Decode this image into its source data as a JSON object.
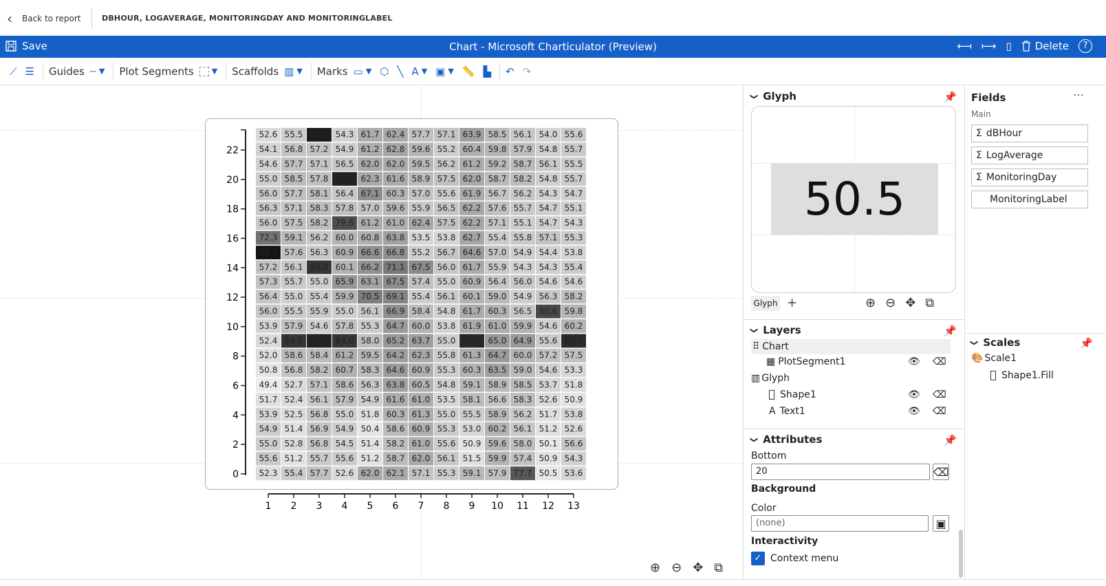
{
  "header": {
    "back_label": "Back to report",
    "report_title": "DBHOUR, LOGAVERAGE, MONITORINGDAY AND MONITORINGLABEL"
  },
  "titlebar": {
    "save_label": "Save",
    "title": "Chart - Microsoft Charticulator (Preview)",
    "delete_label": "Delete"
  },
  "toolbar": {
    "guides_label": "Guides",
    "plot_segments_label": "Plot Segments",
    "scaffolds_label": "Scaffolds",
    "marks_label": "Marks"
  },
  "glyph_panel": {
    "title": "Glyph",
    "preview_value": "50.5",
    "tab_label": "Glyph"
  },
  "layers_panel": {
    "title": "Layers",
    "items": [
      {
        "label": "Chart"
      },
      {
        "label": "PlotSegment1"
      },
      {
        "label": "Glyph"
      },
      {
        "label": "Shape1"
      },
      {
        "label": "Text1"
      }
    ]
  },
  "attributes_panel": {
    "title": "Attributes",
    "bottom_label": "Bottom",
    "bottom_value": "20",
    "background_label": "Background",
    "color_label": "Color",
    "color_value": "(none)",
    "interactivity_label": "Interactivity",
    "context_menu_label": "Context menu",
    "context_menu_checked": true
  },
  "fields_panel": {
    "title": "Fields",
    "group": "Main",
    "fields": [
      {
        "label": "dBHour",
        "sigma": true
      },
      {
        "label": "LogAverage",
        "sigma": true
      },
      {
        "label": "MonitoringDay",
        "sigma": true
      },
      {
        "label": "MonitoringLabel",
        "sigma": false
      }
    ]
  },
  "scales_panel": {
    "title": "Scales",
    "scale_name": "Scale1",
    "scale_item": "Shape1.Fill"
  },
  "colors": {
    "accent": "#1560c8"
  },
  "chart_data": {
    "type": "heatmap",
    "x_ticks": [
      "1",
      "2",
      "3",
      "4",
      "5",
      "6",
      "7",
      "8",
      "9",
      "10",
      "11",
      "12",
      "13"
    ],
    "y_ticks": [
      "0",
      "2",
      "4",
      "6",
      "8",
      "10",
      "12",
      "14",
      "16",
      "18",
      "20",
      "22"
    ],
    "rows_top_to_bottom": [
      [
        52.6,
        55.5,
        88.9,
        54.3,
        61.7,
        62.4,
        57.7,
        57.1,
        63.9,
        58.5,
        56.1,
        54.0,
        55.6
      ],
      [
        54.1,
        56.8,
        57.2,
        54.9,
        61.2,
        62.8,
        59.6,
        55.2,
        60.4,
        59.8,
        57.9,
        54.8,
        55.7
      ],
      [
        54.6,
        57.7,
        57.1,
        56.5,
        62.0,
        62.0,
        59.5,
        56.2,
        61.2,
        59.2,
        58.7,
        56.1,
        55.5
      ],
      [
        55.0,
        58.5,
        57.8,
        87.9,
        62.3,
        61.6,
        58.9,
        57.5,
        62.0,
        58.7,
        58.2,
        54.8,
        55.7
      ],
      [
        56.0,
        57.7,
        58.1,
        56.4,
        67.1,
        60.3,
        57.0,
        55.6,
        61.9,
        56.7,
        56.2,
        54.3,
        54.7
      ],
      [
        56.3,
        57.1,
        58.3,
        57.8,
        57.0,
        59.6,
        55.9,
        56.5,
        62.2,
        57.6,
        55.7,
        54.7,
        55.1
      ],
      [
        56.0,
        57.5,
        58.2,
        79.6,
        61.2,
        61.0,
        62.4,
        57.5,
        62.2,
        57.1,
        55.1,
        54.7,
        54.3
      ],
      [
        72.3,
        59.1,
        56.2,
        60.0,
        60.8,
        63.8,
        53.5,
        53.8,
        62.7,
        55.4,
        55.8,
        57.1,
        55.3
      ],
      [
        90.5,
        57.6,
        56.3,
        60.9,
        66.6,
        66.8,
        55.2,
        56.7,
        64.6,
        57.0,
        54.9,
        54.4,
        53.8
      ],
      [
        57.2,
        56.1,
        84.0,
        60.1,
        66.2,
        71.1,
        67.5,
        56.0,
        61.7,
        55.9,
        54.3,
        54.3,
        55.4
      ],
      [
        57.3,
        55.7,
        55.0,
        65.9,
        63.1,
        67.5,
        57.4,
        55.0,
        60.9,
        56.4,
        56.0,
        54.6,
        54.6
      ],
      [
        56.4,
        55.0,
        55.4,
        59.9,
        70.5,
        69.1,
        55.4,
        56.1,
        60.1,
        59.0,
        54.9,
        56.3,
        58.2
      ],
      [
        56.0,
        55.5,
        55.9,
        55.0,
        56.1,
        66.9,
        58.4,
        54.8,
        61.7,
        60.3,
        56.5,
        80.6,
        59.8
      ],
      [
        53.9,
        57.9,
        54.6,
        57.8,
        55.3,
        64.7,
        60.0,
        53.8,
        61.9,
        61.0,
        59.9,
        54.6,
        60.2
      ],
      [
        52.4,
        84.1,
        87.7,
        84.0,
        58.0,
        65.2,
        63.7,
        55.0,
        86.7,
        65.0,
        64.9,
        55.6,
        86.1
      ],
      [
        52.0,
        58.6,
        58.4,
        61.2,
        59.5,
        64.2,
        62.3,
        55.8,
        61.3,
        64.7,
        60.0,
        57.2,
        57.5
      ],
      [
        50.8,
        56.8,
        58.2,
        60.7,
        58.3,
        64.6,
        60.9,
        55.3,
        60.3,
        63.5,
        59.0,
        54.6,
        53.3
      ],
      [
        49.4,
        52.7,
        57.1,
        58.6,
        56.3,
        63.8,
        60.5,
        54.8,
        59.1,
        58.9,
        58.5,
        53.7,
        51.8
      ],
      [
        51.7,
        52.4,
        56.1,
        57.9,
        54.9,
        61.6,
        61.0,
        53.5,
        58.1,
        56.6,
        58.3,
        52.6,
        50.9
      ],
      [
        53.9,
        52.5,
        56.8,
        55.0,
        51.8,
        60.3,
        61.3,
        55.0,
        55.5,
        58.9,
        56.2,
        51.7,
        53.8
      ],
      [
        54.9,
        51.4,
        56.9,
        54.9,
        50.4,
        58.6,
        60.9,
        55.3,
        53.0,
        60.2,
        56.1,
        51.2,
        52.6
      ],
      [
        55.0,
        52.8,
        56.8,
        54.5,
        51.4,
        58.2,
        61.0,
        55.6,
        50.9,
        59.6,
        58.0,
        50.1,
        56.6
      ],
      [
        55.6,
        51.2,
        55.7,
        55.6,
        51.2,
        58.7,
        62.0,
        56.1,
        51.5,
        59.9,
        57.4,
        50.9,
        54.3
      ],
      [
        52.3,
        55.4,
        57.7,
        52.6,
        62.0,
        62.1,
        57.1,
        55.3,
        59.1,
        57.9,
        77.7,
        50.5,
        53.6
      ]
    ]
  }
}
